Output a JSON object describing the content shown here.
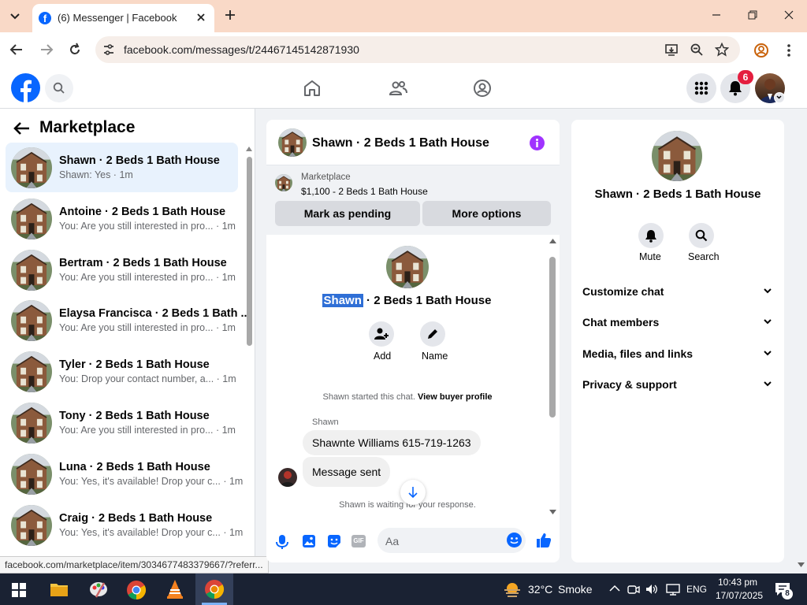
{
  "browser": {
    "tab_title": "(6) Messenger | Facebook",
    "url": "facebook.com/messages/t/24467145142871930",
    "status_url": "facebook.com/marketplace/item/3034677483379667/?referr..."
  },
  "header": {
    "notification_count": "6",
    "accent_color": "#0866ff"
  },
  "sidebar": {
    "title": "Marketplace",
    "conversations": [
      {
        "name": "Shawn · 2 Beds 1 Bath House",
        "preview": "Shawn: Yes · 1m",
        "time": ""
      },
      {
        "name": "Antoine · 2 Beds 1 Bath House",
        "preview": "You: Are you still interested in pro...",
        "time": "· 1m"
      },
      {
        "name": "Bertram · 2 Beds 1 Bath House",
        "preview": "You: Are you still interested in pro...",
        "time": "· 1m"
      },
      {
        "name": "Elaysa Francisca · 2 Beds 1 Bath ...",
        "preview": "You: Are you still interested in pro...",
        "time": "· 1m"
      },
      {
        "name": "Tyler · 2 Beds 1 Bath House",
        "preview": "You: Drop your contact number, a...",
        "time": "· 1m"
      },
      {
        "name": "Tony · 2 Beds 1 Bath House",
        "preview": "You: Are you still interested in pro...",
        "time": "· 1m"
      },
      {
        "name": "Luna · 2 Beds 1 Bath House",
        "preview": "You: Yes, it's available! Drop your c...",
        "time": "· 1m"
      },
      {
        "name": "Craig · 2 Beds 1 Bath House",
        "preview": "You: Yes, it's available! Drop your c...",
        "time": "· 1m"
      }
    ]
  },
  "chat": {
    "title": "Shawn · 2 Beds 1 Bath House",
    "listing_label": "Marketplace",
    "listing_title": "$1,100 - 2 Beds 1 Bath House",
    "mark_pending": "Mark as pending",
    "more_options": "More options",
    "profile_name_first": "Shawn",
    "profile_name_rest": " · 2 Beds 1 Bath House",
    "add_label": "Add",
    "name_label": "Name",
    "started_text": "Shawn started this chat.",
    "view_buyer": "View buyer profile",
    "sender_label": "Shawn",
    "messages": [
      "Shawnte Williams 615-719-1263",
      "Message sent"
    ],
    "waiting_text": "Shawn is waiting for your response.",
    "input_placeholder": "Aa"
  },
  "info": {
    "title": "Shawn · 2 Beds 1 Bath House",
    "mute": "Mute",
    "search": "Search",
    "sections": [
      "Customize chat",
      "Chat members",
      "Media, files and links",
      "Privacy & support"
    ]
  },
  "taskbar": {
    "temperature": "32°C",
    "weather": "Smoke",
    "language": "ENG",
    "time": "10:43 pm",
    "date": "17/07/2025",
    "notif_count": "8"
  }
}
